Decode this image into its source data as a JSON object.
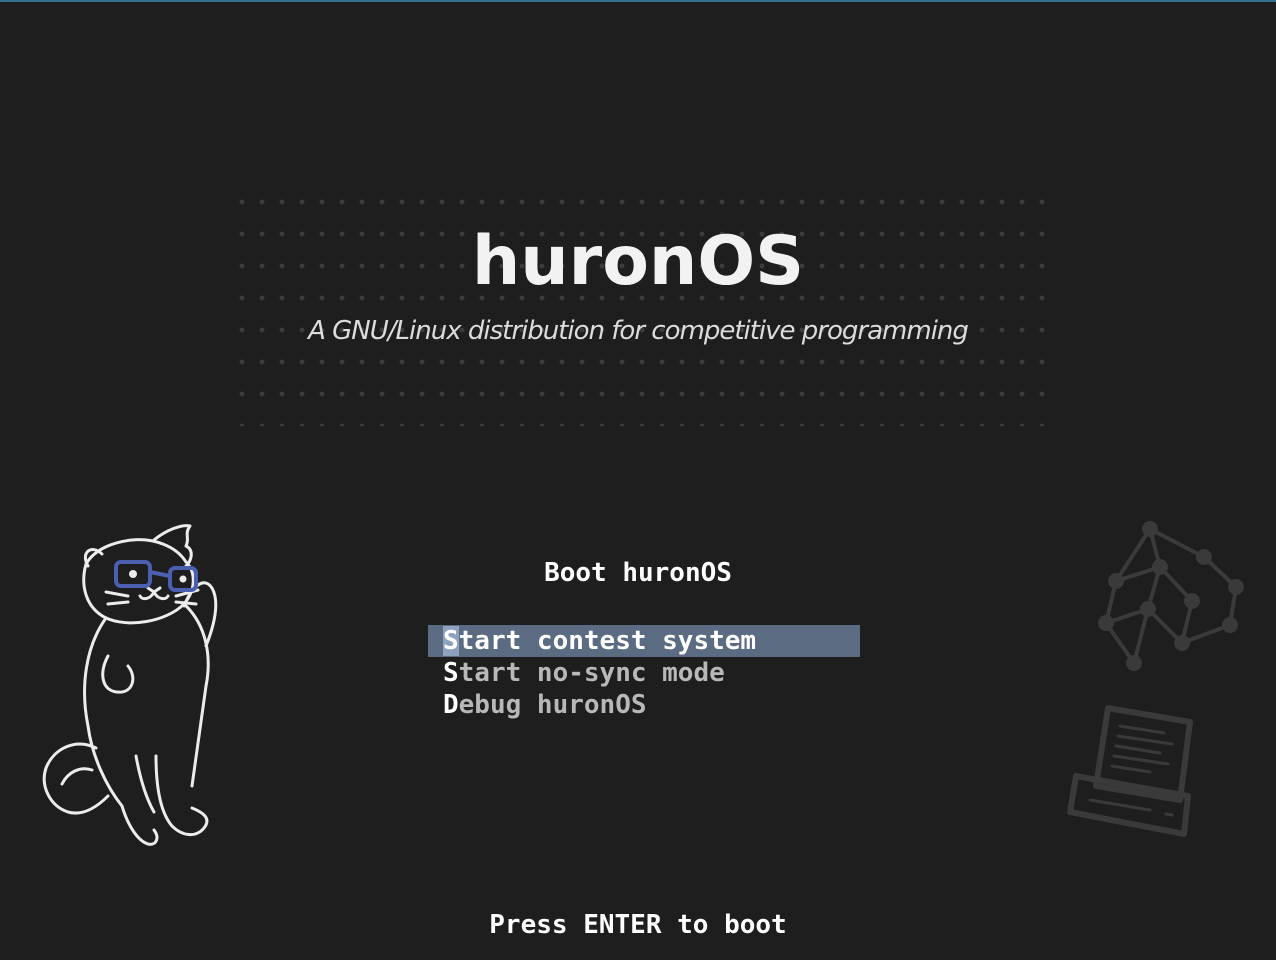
{
  "brand": {
    "title": "huronOS",
    "subtitle": "A GNU/Linux distribution for competitive programming"
  },
  "boot_menu": {
    "title": "Boot huronOS",
    "selected_index": 0,
    "items": [
      {
        "hotkey": "S",
        "rest": "tart contest system"
      },
      {
        "hotkey": "S",
        "rest": "tart no-sync mode"
      },
      {
        "hotkey": "D",
        "rest": "ebug huronOS"
      }
    ]
  },
  "footer": {
    "hint": "Press ENTER to boot"
  },
  "decorations": {
    "mascot_icon": "otter-with-glasses-icon",
    "graph_icon": "node-graph-icon",
    "computer_icon": "retro-computer-icon"
  },
  "colors": {
    "background": "#1e1e1f",
    "selection": "#5b6c82",
    "selection_hotkey": "#8ea2c0",
    "glasses": "#4a5fb0"
  }
}
